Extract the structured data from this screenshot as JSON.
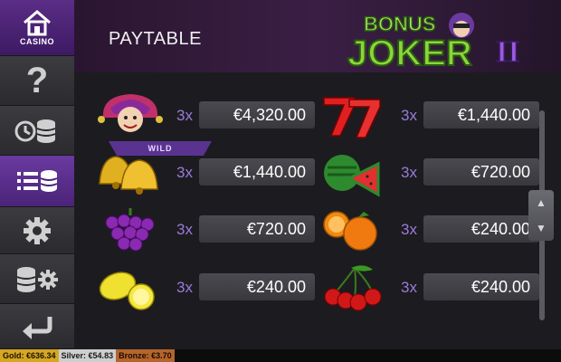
{
  "sidebar": {
    "casino_label": "CASINO",
    "help_glyph": "?"
  },
  "header": {
    "title": "PAYTABLE",
    "logo_top": "BONUS",
    "logo_main": "JOKER",
    "logo_numeral": "II"
  },
  "paytable": {
    "rows": [
      {
        "symbol": "joker-icon",
        "multiplier": "3x",
        "value": "€4,320.00",
        "badge": "WILD"
      },
      {
        "symbol": "sevens-icon",
        "multiplier": "3x",
        "value": "€1,440.00"
      },
      {
        "symbol": "bells-icon",
        "multiplier": "3x",
        "value": "€1,440.00"
      },
      {
        "symbol": "watermelon-icon",
        "multiplier": "3x",
        "value": "€720.00"
      },
      {
        "symbol": "grapes-icon",
        "multiplier": "3x",
        "value": "€720.00"
      },
      {
        "symbol": "oranges-icon",
        "multiplier": "3x",
        "value": "€240.00"
      },
      {
        "symbol": "lemons-icon",
        "multiplier": "3x",
        "value": "€240.00"
      },
      {
        "symbol": "cherries-icon",
        "multiplier": "3x",
        "value": "€240.00"
      }
    ]
  },
  "scroll": {
    "up": "▲",
    "down": "▼"
  },
  "footer": {
    "gold": "Gold: €636.34",
    "silver": "Silver: €54.83",
    "bronze": "Bronze: €3.70"
  },
  "colors": {
    "accent": "#5a3390",
    "multiplier": "#9b7ad9",
    "gold": "#d6a622",
    "silver": "#cfcfcf",
    "bronze": "#b5652b"
  }
}
